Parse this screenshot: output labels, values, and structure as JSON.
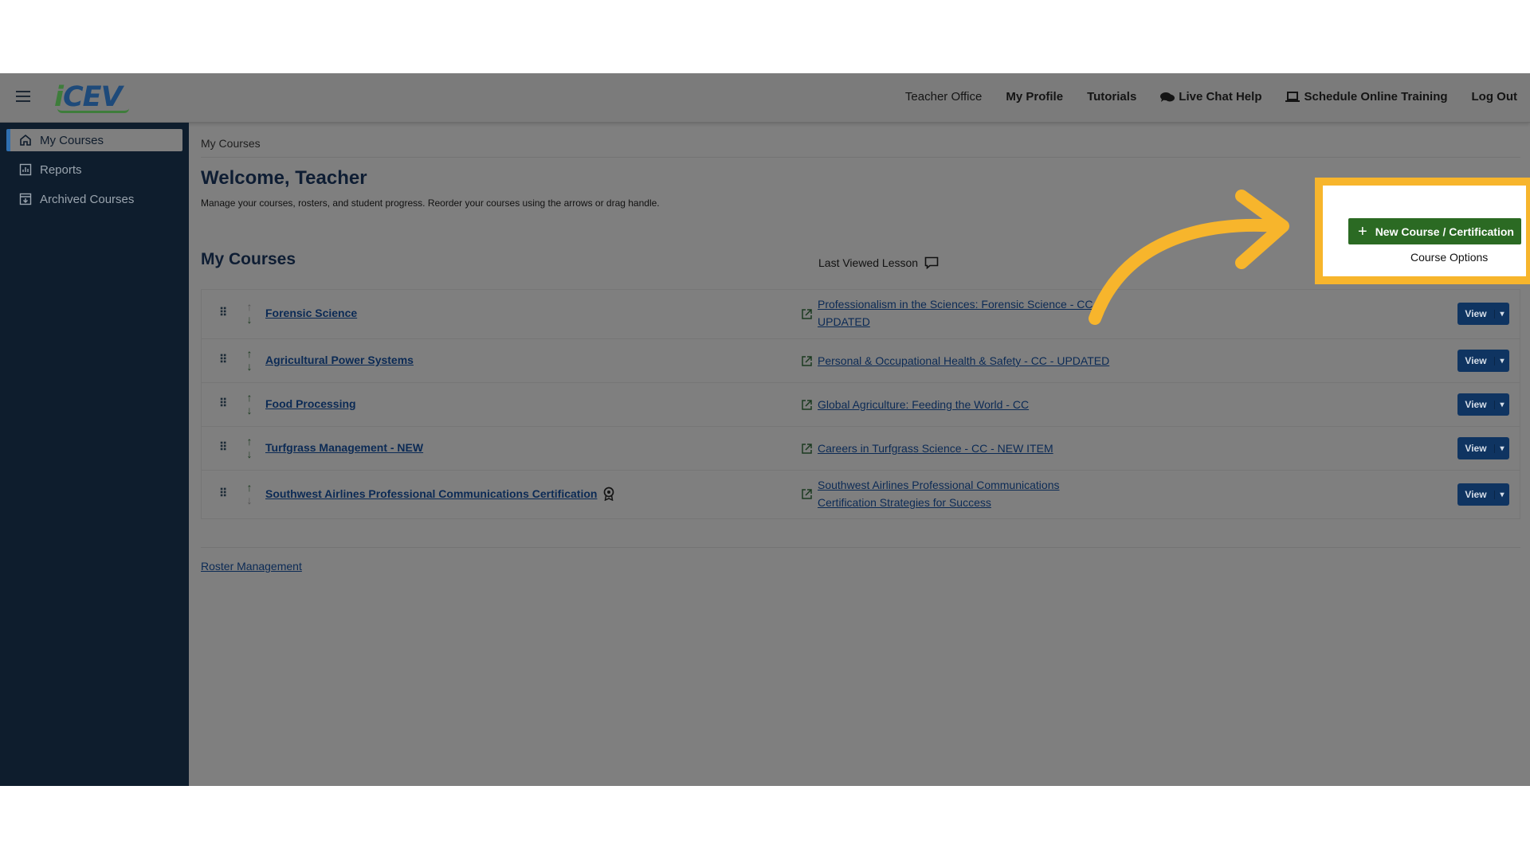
{
  "brand": {
    "logo_i": "i",
    "logo_text": "CEV"
  },
  "topnav": [
    {
      "id": "teacher-office",
      "label": "Teacher Office",
      "bold": false
    },
    {
      "id": "my-profile",
      "label": "My Profile",
      "bold": true
    },
    {
      "id": "tutorials",
      "label": "Tutorials",
      "bold": true
    },
    {
      "id": "live-chat-help",
      "label": "Live Chat Help",
      "bold": true,
      "icon": "chat-icon"
    },
    {
      "id": "schedule-online-training",
      "label": "Schedule Online Training",
      "bold": true,
      "icon": "laptop-icon"
    },
    {
      "id": "log-out",
      "label": "Log Out",
      "bold": true
    }
  ],
  "sidebar": {
    "items": [
      {
        "label": "My Courses",
        "icon": "home-icon",
        "active": true
      },
      {
        "label": "Reports",
        "icon": "chart-icon",
        "active": false
      },
      {
        "label": "Archived Courses",
        "icon": "archive-icon",
        "active": false
      }
    ]
  },
  "main": {
    "breadcrumb": "My Courses",
    "welcome": "Welcome, Teacher",
    "welcome_sub": "Manage your courses, rosters, and student progress. Reorder your courses using the arrows or drag handle.",
    "section_title": "My Courses",
    "last_viewed_header": "Last Viewed Lesson",
    "new_course_button": "New Course / Certification",
    "course_options": "Course Options",
    "roster_link": "Roster Management",
    "view_label": "View",
    "courses": [
      {
        "name": "Forensic Science",
        "lesson": "Professionalism in the Sciences: Forensic Science - CC - UPDATED",
        "certification": false
      },
      {
        "name": "Agricultural Power Systems",
        "lesson": "Personal & Occupational Health & Safety - CC - UPDATED",
        "certification": false
      },
      {
        "name": "Food Processing",
        "lesson": "Global Agriculture: Feeding the World - CC",
        "certification": false
      },
      {
        "name": "Turfgrass Management - NEW",
        "lesson": "Careers in Turfgrass Science - CC - NEW ITEM",
        "certification": false
      },
      {
        "name": "Southwest Airlines Professional Communications Certification",
        "lesson": "Southwest Airlines Professional Communications Certification Strategies for Success",
        "certification": true
      }
    ]
  },
  "colors": {
    "accent_highlight": "#f7b52c",
    "sidebar_bg": "#0e1d2d",
    "new_course_bg": "#2b6a23",
    "view_button_bg": "#0f3461"
  }
}
